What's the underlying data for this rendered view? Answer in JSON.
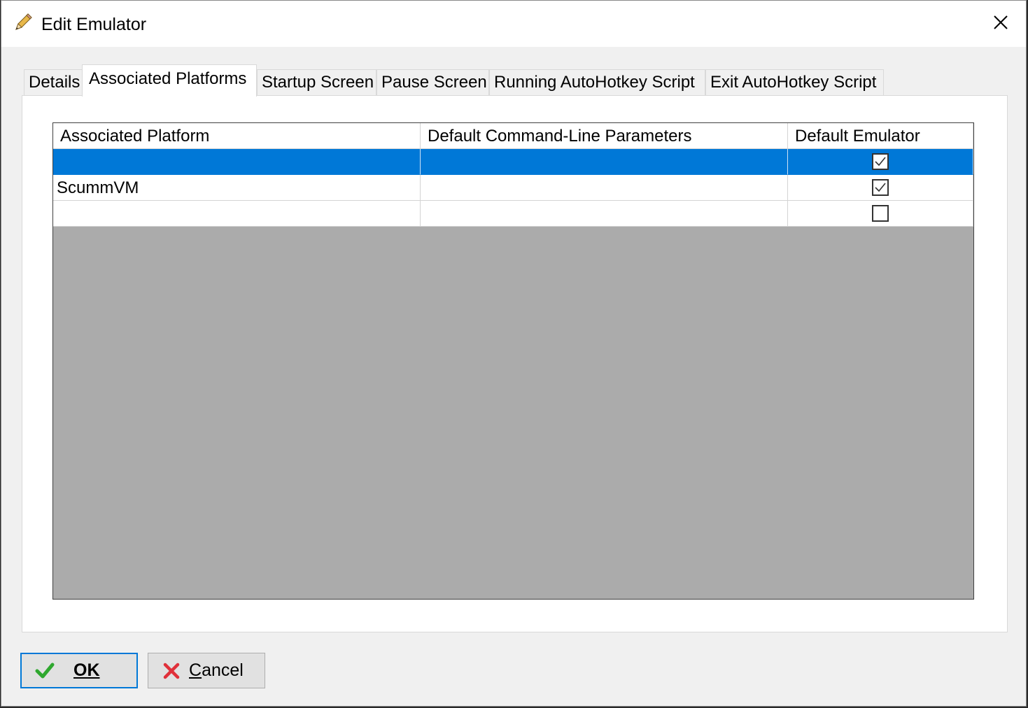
{
  "window": {
    "title": "Edit Emulator",
    "title_icon": "pencil-icon",
    "close_icon": "close-icon"
  },
  "tabs": [
    {
      "label": "Details",
      "active": false
    },
    {
      "label": "Associated Platforms",
      "active": true
    },
    {
      "label": "Startup Screen",
      "active": false
    },
    {
      "label": "Pause Screen",
      "active": false
    },
    {
      "label": "Running AutoHotkey Script",
      "active": false
    },
    {
      "label": "Exit AutoHotkey Script",
      "active": false
    }
  ],
  "grid": {
    "columns": [
      "Associated Platform",
      "Default Command-Line Parameters",
      "Default Emulator"
    ],
    "rows": [
      {
        "platform": "",
        "params": "",
        "default": true,
        "selected": true
      },
      {
        "platform": "ScummVM",
        "params": "",
        "default": true,
        "selected": false
      },
      {
        "platform": "",
        "params": "",
        "default": false,
        "selected": false
      }
    ]
  },
  "buttons": {
    "ok_label": "OK",
    "ok_icon": "checkmark-icon",
    "cancel_label": "Cancel",
    "cancel_icon": "x-icon"
  },
  "colors": {
    "selection": "#0078d7",
    "empty_area": "#ababab",
    "ok_border": "#0078d7",
    "check_green": "#2fa82f",
    "cancel_red": "#e0303a"
  }
}
